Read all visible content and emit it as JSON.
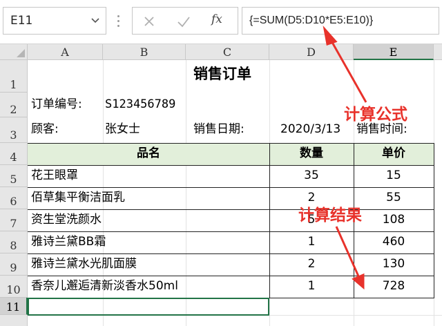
{
  "formula_bar": {
    "name_box": "E11",
    "formula": "{=SUM(D5:D10*E5:E10)}"
  },
  "columns": [
    "A",
    "B",
    "C",
    "D",
    "E"
  ],
  "rows": [
    "1",
    "2",
    "3",
    "4",
    "5",
    "6",
    "7",
    "8",
    "9",
    "10",
    "11"
  ],
  "sheet": {
    "title": "销售订单",
    "order_no_label": "订单编号:",
    "order_no": "S123456789",
    "customer_label": "顾客:",
    "customer": "张女士",
    "sale_date_label": "销售日期:",
    "sale_date": "2020/3/13",
    "sale_time_label": "销售时间:",
    "headers": [
      "品名",
      "数量",
      "单价"
    ],
    "items": [
      {
        "name": "花王眼罩",
        "qty": "35",
        "price": "15"
      },
      {
        "name": "佰草集平衡洁面乳",
        "qty": "2",
        "price": "55"
      },
      {
        "name": "资生堂洗颜水",
        "qty": "5",
        "price": "108"
      },
      {
        "name": "雅诗兰黛BB霜",
        "qty": "1",
        "price": "460"
      },
      {
        "name": "雅诗兰黛水光肌面膜",
        "qty": "2",
        "price": "130"
      },
      {
        "name": "香奈儿邂逅清新淡香水50ml",
        "qty": "1",
        "price": "728"
      }
    ]
  },
  "annotations": {
    "formula_note": "计算公式",
    "result_note": "计算结果"
  },
  "colors": {
    "header_fill": "#e2efda",
    "selection": "#217346",
    "annotation": "#e8322b"
  },
  "icons": [
    "dropdown-icon",
    "cancel-icon",
    "enter-icon",
    "insert-function-icon"
  ]
}
